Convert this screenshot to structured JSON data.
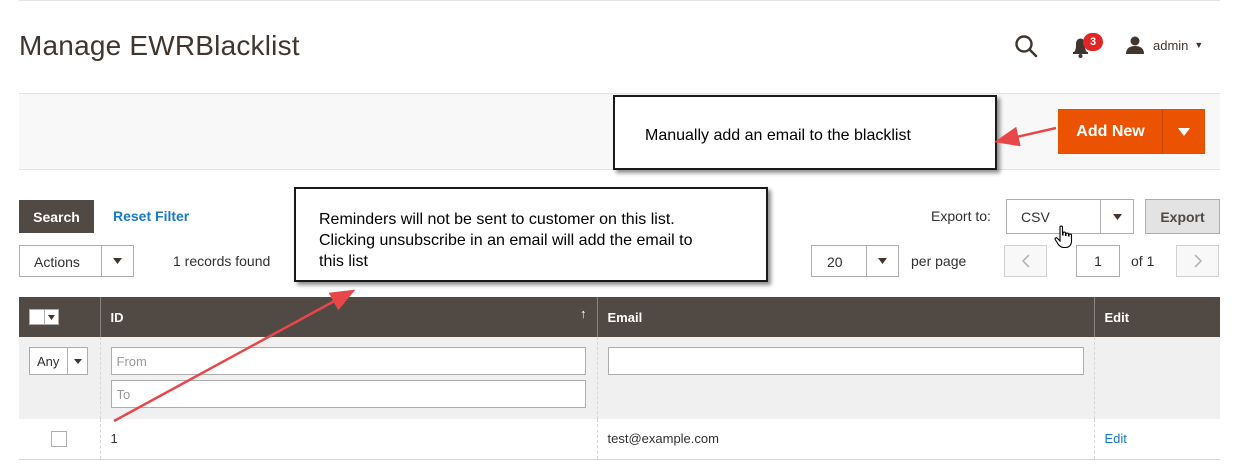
{
  "page": {
    "title": "Manage EWRBlacklist"
  },
  "header": {
    "notification_count": "3",
    "user_name": "admin",
    "icons": [
      "search-icon",
      "bell-icon",
      "user-icon",
      "caret-down-icon"
    ]
  },
  "toolbar": {
    "add_new_label": "Add New"
  },
  "grid_controls": {
    "search_label": "Search",
    "reset_filter_label": "Reset Filter",
    "export_to_label": "Export to:",
    "export_format": "CSV",
    "export_button_label": "Export",
    "actions_label": "Actions",
    "records_found": "1 records found",
    "per_page_value": "20",
    "per_page_label": "per page",
    "current_page": "1",
    "page_total": "of 1"
  },
  "grid": {
    "columns": [
      {
        "label": "ID",
        "sort": "↑"
      },
      {
        "label": "Email"
      },
      {
        "label": "Edit"
      }
    ],
    "filters": {
      "mass_select_value": "Any",
      "id_from_placeholder": "From",
      "id_to_placeholder": "To"
    },
    "rows": [
      {
        "id": "1",
        "email": "test@example.com",
        "action": "Edit"
      }
    ]
  },
  "annotations": {
    "callout_add": "Manually add an email to the blacklist",
    "callout_list_line1": "Reminders will not be sent to customer on this list.",
    "callout_list_line2": "Clicking unsubscribe in an email will add the email to",
    "callout_list_line3": "this list"
  },
  "colors": {
    "accent": "#eb5202",
    "header_dark": "#514943",
    "link": "#1979c3",
    "badge": "#e22626",
    "annotation_arrow": "#e8474a"
  }
}
